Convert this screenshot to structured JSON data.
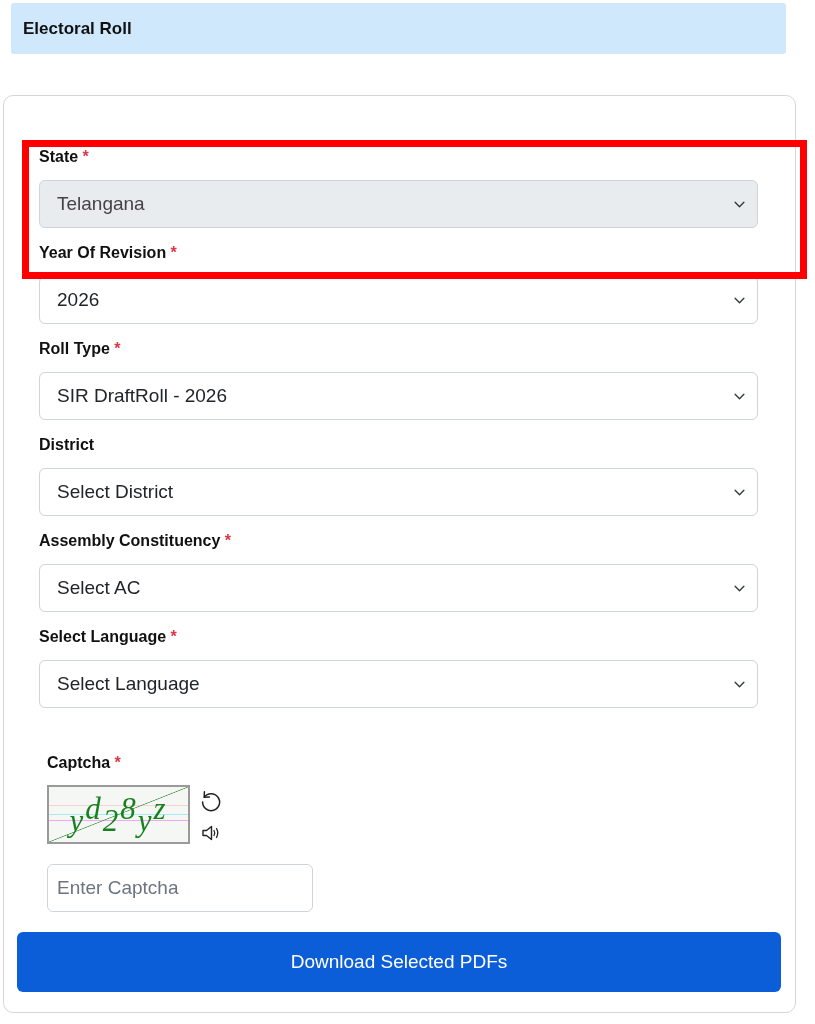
{
  "header": {
    "title": "Electoral Roll"
  },
  "form": {
    "fields": [
      {
        "label": "State",
        "required_mark": "*",
        "value": "Telangana",
        "disabled": true
      },
      {
        "label": "Year Of Revision",
        "required_mark": "*",
        "value": "2026",
        "disabled": false
      },
      {
        "label": "Roll Type",
        "required_mark": "*",
        "value": "SIR DraftRoll - 2026",
        "disabled": false
      },
      {
        "label": "District",
        "value": "Select District",
        "disabled": false
      },
      {
        "label": "Assembly Constituency",
        "required_mark": "*",
        "value": "Select AC",
        "disabled": false
      },
      {
        "label": "Select Language",
        "required_mark": "*",
        "value": "Select Language",
        "disabled": false
      }
    ],
    "captcha": {
      "label": "Captcha",
      "required_mark": "*",
      "code": "yd28yz",
      "placeholder": "Enter Captcha"
    },
    "submit_button": {
      "label": "Download Selected PDFs"
    }
  },
  "annotation_frame": {
    "visible": true
  }
}
